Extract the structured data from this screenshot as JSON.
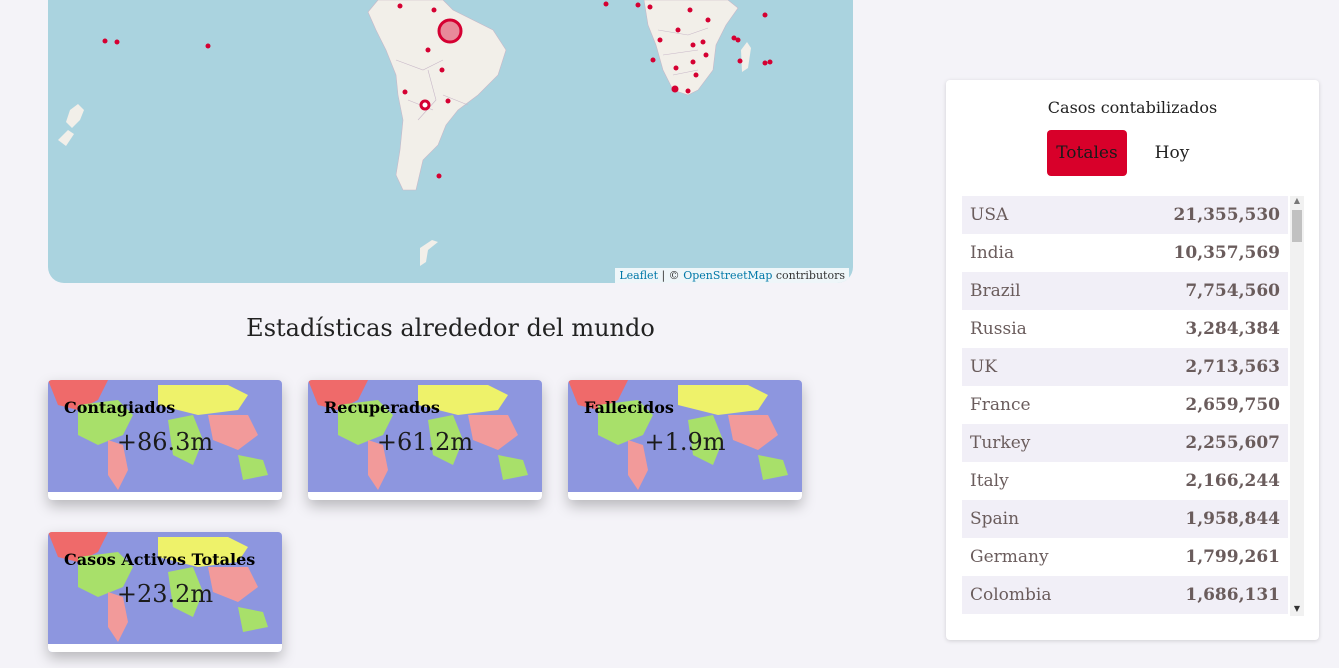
{
  "map": {
    "attribution": {
      "leaflet": "Leaflet",
      "sep": " | © ",
      "osm": "OpenStreetMap",
      "suffix": " contributors"
    }
  },
  "stats": {
    "title": "Estadísticas alrededor del mundo",
    "cards": [
      {
        "label": "Contagiados",
        "value": "+86.3m"
      },
      {
        "label": "Recuperados",
        "value": "+61.2m"
      },
      {
        "label": "Fallecidos",
        "value": "+1.9m"
      },
      {
        "label": "Casos Activos Totales",
        "value": "+23.2m"
      }
    ]
  },
  "panel": {
    "title": "Casos contabilizados",
    "tabs": {
      "totales": "Totales",
      "hoy": "Hoy"
    },
    "active_tab": "Totales",
    "countries": [
      {
        "name": "USA",
        "cases": "21,355,530"
      },
      {
        "name": "India",
        "cases": "10,357,569"
      },
      {
        "name": "Brazil",
        "cases": "7,754,560"
      },
      {
        "name": "Russia",
        "cases": "3,284,384"
      },
      {
        "name": "UK",
        "cases": "2,713,563"
      },
      {
        "name": "France",
        "cases": "2,659,750"
      },
      {
        "name": "Turkey",
        "cases": "2,255,607"
      },
      {
        "name": "Italy",
        "cases": "2,166,244"
      },
      {
        "name": "Spain",
        "cases": "1,958,844"
      },
      {
        "name": "Germany",
        "cases": "1,799,261"
      },
      {
        "name": "Colombia",
        "cases": "1,686,131"
      }
    ]
  },
  "colors": {
    "accent": "#d8002a",
    "map_water": "#aad3df",
    "map_land": "#f2efe9",
    "marker": "#d50032",
    "page_bg": "#f4f3f8"
  }
}
